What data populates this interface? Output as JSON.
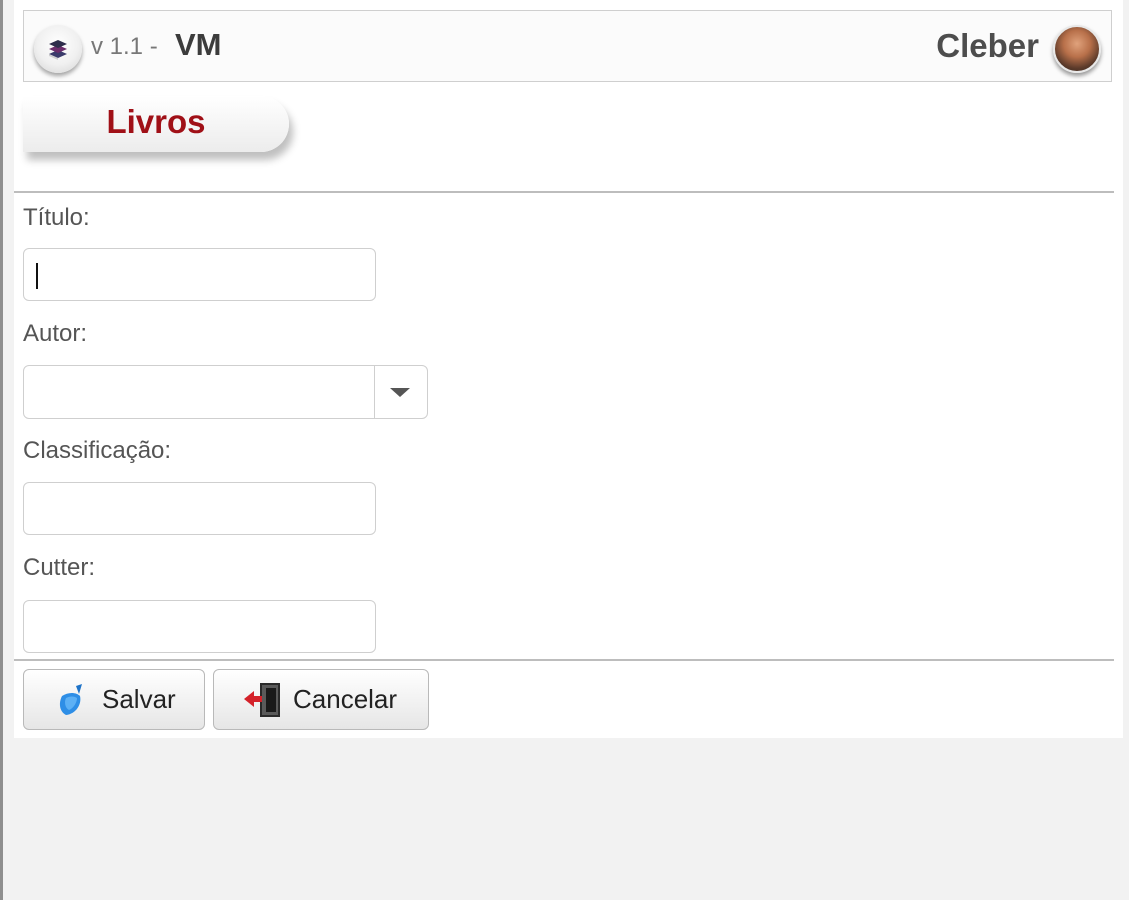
{
  "header": {
    "logo_icon": "book-stack-icon",
    "version": "v 1.1 -",
    "app_name": "VM",
    "user_name": "Cleber",
    "avatar_icon": "user-avatar"
  },
  "page": {
    "title": "Livros"
  },
  "form": {
    "titulo": {
      "label": "Título:",
      "value": ""
    },
    "autor": {
      "label": "Autor:",
      "selected": "",
      "arrow_icon": "chevron-down-icon"
    },
    "classificacao": {
      "label": "Classificação:",
      "value": ""
    },
    "cutter": {
      "label": "Cutter:",
      "value": ""
    }
  },
  "actions": {
    "save_label": "Salvar",
    "save_icon": "broom-icon",
    "cancel_label": "Cancelar",
    "cancel_icon": "exit-door-icon"
  },
  "colors": {
    "title": "#a01017",
    "background": "#f2f2f2",
    "panel": "#ffffff"
  }
}
